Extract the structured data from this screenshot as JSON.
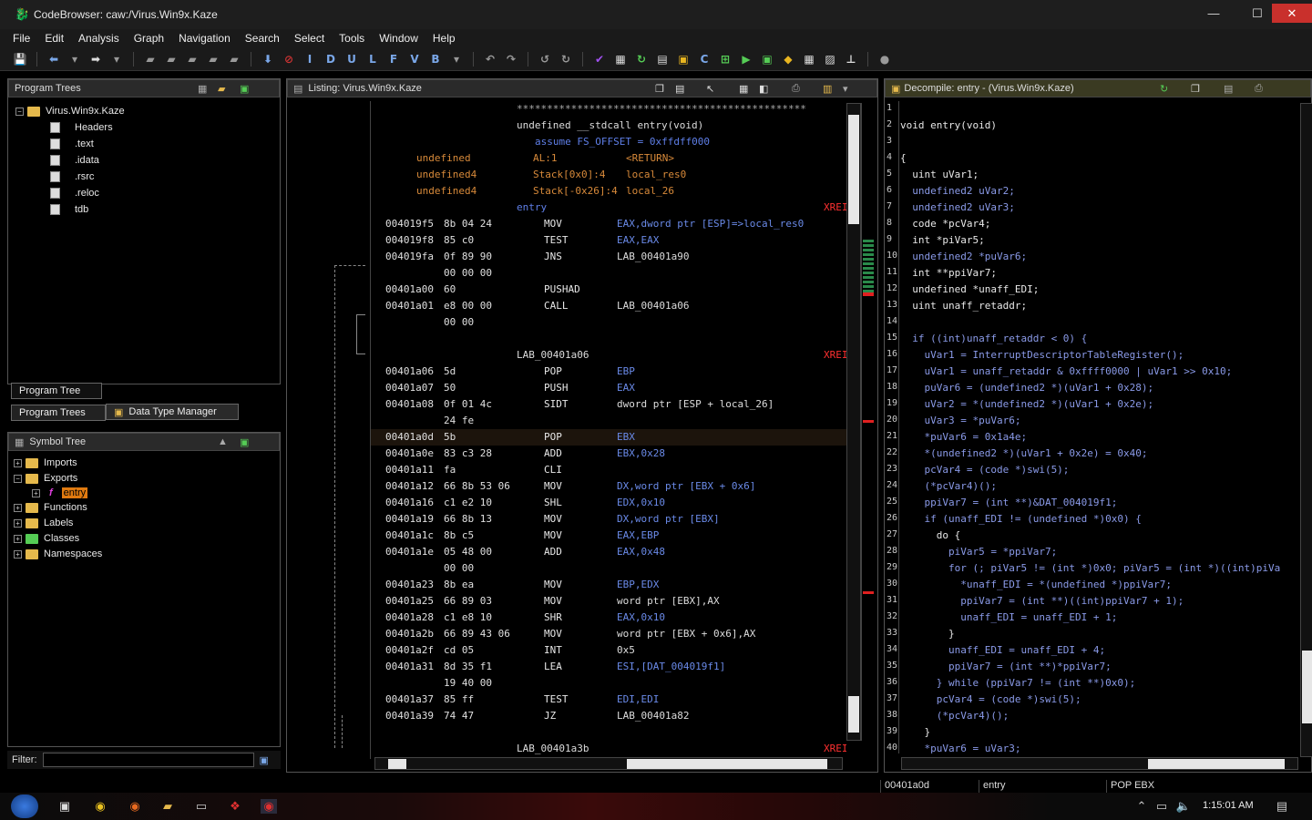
{
  "window": {
    "title": "CodeBrowser: caw:/Virus.Win9x.Kaze"
  },
  "menu": [
    "File",
    "Edit",
    "Analysis",
    "Graph",
    "Navigation",
    "Search",
    "Select",
    "Tools",
    "Window",
    "Help"
  ],
  "toolbar": {
    "letters": [
      "I",
      "D",
      "U",
      "L",
      "F",
      "V",
      "B"
    ]
  },
  "program_trees": {
    "title": "Program Trees",
    "root": "Virus.Win9x.Kaze",
    "items": [
      "Headers",
      ".text",
      ".idata",
      ".rsrc",
      ".reloc",
      "tdb"
    ],
    "tab_tree": "Program Tree",
    "tab_trees": "Program Trees",
    "tab_dtm": "Data Type Manager"
  },
  "symbol_tree": {
    "title": "Symbol Tree",
    "items": [
      {
        "label": "Imports"
      },
      {
        "label": "Exports"
      },
      {
        "label": "entry"
      },
      {
        "label": "Functions"
      },
      {
        "label": "Labels"
      },
      {
        "label": "Classes"
      },
      {
        "label": "Namespaces"
      }
    ],
    "filter_label": "Filter:"
  },
  "listing": {
    "title": "Listing:  Virus.Win9x.Kaze",
    "header": {
      "stars": "************************************************",
      "sig": "undefined __stdcall entry(void)",
      "assume": "assume FS_OFFSET = 0xffdff000",
      "vars": [
        [
          "undefined",
          "AL:1",
          "<RETURN>"
        ],
        [
          "undefined4",
          "Stack[0x0]:4",
          "local_res0"
        ],
        [
          "undefined4",
          "Stack[-0x26]:4",
          "local_26"
        ]
      ],
      "entry": "entry",
      "xref": "XREI"
    },
    "rows": [
      [
        "004019f5",
        "8b 04 24",
        "MOV",
        "EAX,dword ptr [ESP]=>local_res0"
      ],
      [
        "004019f8",
        "85 c0",
        "TEST",
        "EAX,EAX"
      ],
      [
        "004019fa",
        "0f 89 90",
        "JNS",
        "LAB_00401a90"
      ],
      [
        "",
        "00 00 00",
        "",
        ""
      ],
      [
        "00401a00",
        "60",
        "PUSHAD",
        ""
      ],
      [
        "00401a01",
        "e8 00 00",
        "CALL",
        "LAB_00401a06"
      ],
      [
        "",
        "00 00",
        "",
        ""
      ],
      [
        "",
        "",
        "",
        ""
      ],
      [
        "",
        "",
        "LAB",
        ""
      ],
      [
        "00401a06",
        "5d",
        "POP",
        "EBP"
      ],
      [
        "00401a07",
        "50",
        "PUSH",
        "EAX"
      ],
      [
        "00401a08",
        "0f 01 4c",
        "SIDT",
        "dword ptr [ESP + local_26]"
      ],
      [
        "",
        "24 fe",
        "",
        ""
      ],
      [
        "00401a0d",
        "5b",
        "POP",
        "EBX"
      ],
      [
        "00401a0e",
        "83 c3 28",
        "ADD",
        "EBX,0x28"
      ],
      [
        "00401a11",
        "fa",
        "CLI",
        ""
      ],
      [
        "00401a12",
        "66 8b 53 06",
        "MOV",
        "DX,word ptr [EBX + 0x6]"
      ],
      [
        "00401a16",
        "c1 e2 10",
        "SHL",
        "EDX,0x10"
      ],
      [
        "00401a19",
        "66 8b 13",
        "MOV",
        "DX,word ptr [EBX]"
      ],
      [
        "00401a1c",
        "8b c5",
        "MOV",
        "EAX,EBP"
      ],
      [
        "00401a1e",
        "05 48 00",
        "ADD",
        "EAX,0x48"
      ],
      [
        "",
        "00 00",
        "",
        ""
      ],
      [
        "00401a23",
        "8b ea",
        "MOV",
        "EBP,EDX"
      ],
      [
        "00401a25",
        "66 89 03",
        "MOV",
        "word ptr [EBX],AX"
      ],
      [
        "00401a28",
        "c1 e8 10",
        "SHR",
        "EAX,0x10"
      ],
      [
        "00401a2b",
        "66 89 43 06",
        "MOV",
        "word ptr [EBX + 0x6],AX"
      ],
      [
        "00401a2f",
        "cd 05",
        "INT",
        "0x5"
      ],
      [
        "00401a31",
        "8d 35 f1",
        "LEA",
        "ESI,[DAT_004019f1]"
      ],
      [
        "",
        "19 40 00",
        "",
        ""
      ],
      [
        "00401a37",
        "85 ff",
        "TEST",
        "EDI,EDI"
      ],
      [
        "00401a39",
        "74 47",
        "JZ",
        "LAB_00401a82"
      ]
    ],
    "label_a06": "LAB_00401a06",
    "label_a3b": "LAB_00401a3b"
  },
  "decompiler": {
    "title": "Decompile: entry -  (Virus.Win9x.Kaze)",
    "lines": [
      "",
      "void entry(void)",
      "",
      "{",
      "  uint uVar1;",
      "  undefined2 uVar2;",
      "  undefined2 uVar3;",
      "  code *pcVar4;",
      "  int *piVar5;",
      "  undefined2 *puVar6;",
      "  int **ppiVar7;",
      "  undefined *unaff_EDI;",
      "  uint unaff_retaddr;",
      "",
      "  if ((int)unaff_retaddr < 0) {",
      "    uVar1 = InterruptDescriptorTableRegister();",
      "    uVar1 = unaff_retaddr & 0xffff0000 | uVar1 >> 0x10;",
      "    puVar6 = (undefined2 *)(uVar1 + 0x28);",
      "    uVar2 = *(undefined2 *)(uVar1 + 0x2e);",
      "    uVar3 = *puVar6;",
      "    *puVar6 = 0x1a4e;",
      "    *(undefined2 *)(uVar1 + 0x2e) = 0x40;",
      "    pcVar4 = (code *)swi(5);",
      "    (*pcVar4)();",
      "    ppiVar7 = (int **)&DAT_004019f1;",
      "    if (unaff_EDI != (undefined *)0x0) {",
      "      do {",
      "        piVar5 = *ppiVar7;",
      "        for (; piVar5 != (int *)0x0; piVar5 = (int *)((int)piVa",
      "          *unaff_EDI = *(undefined *)ppiVar7;",
      "          ppiVar7 = (int **)((int)ppiVar7 + 1);",
      "          unaff_EDI = unaff_EDI + 1;",
      "        }",
      "        unaff_EDI = unaff_EDI + 4;",
      "        ppiVar7 = (int **)*ppiVar7;",
      "      } while (ppiVar7 != (int **)0x0);",
      "      pcVar4 = (code *)swi(5);",
      "      (*pcVar4)();",
      "    }",
      "    *puVar6 = uVar3;"
    ]
  },
  "status": {
    "address": "00401a0d",
    "function": "entry",
    "instr": "POP EBX"
  },
  "taskbar": {
    "time": "1:15:01 AM"
  },
  "colors": {
    "background": "#000000",
    "keyword_blue": "#5f7fe8",
    "selection_orange": "#e07a10",
    "close_red": "#c9302c"
  }
}
